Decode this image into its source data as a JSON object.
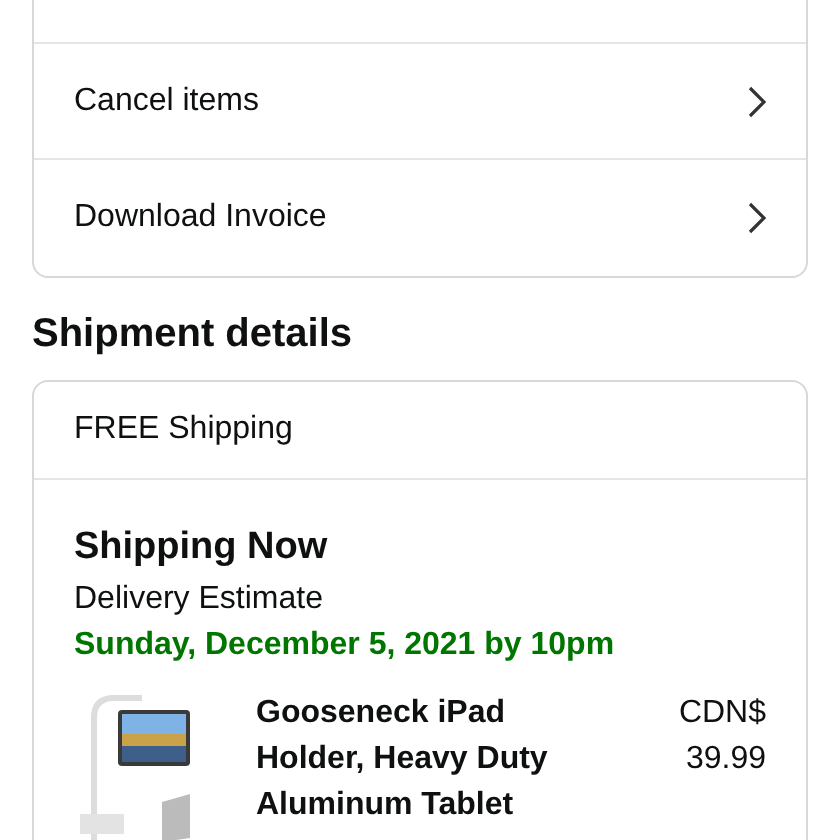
{
  "order_actions": [
    {
      "label": "Cancel items"
    },
    {
      "label": "Download Invoice"
    }
  ],
  "shipment": {
    "heading": "Shipment details",
    "shipping_type": "FREE Shipping",
    "status": "Shipping Now",
    "estimate_label": "Delivery Estimate",
    "estimate_date": "Sunday, December 5, 2021 by 10pm",
    "items": [
      {
        "kind": "picture",
        "title_lines": [
          "Gooseneck iPad",
          "Holder, Heavy Duty",
          "Aluminum Tablet"
        ],
        "price_lines": [
          "CDN$",
          "39.99"
        ]
      }
    ]
  }
}
